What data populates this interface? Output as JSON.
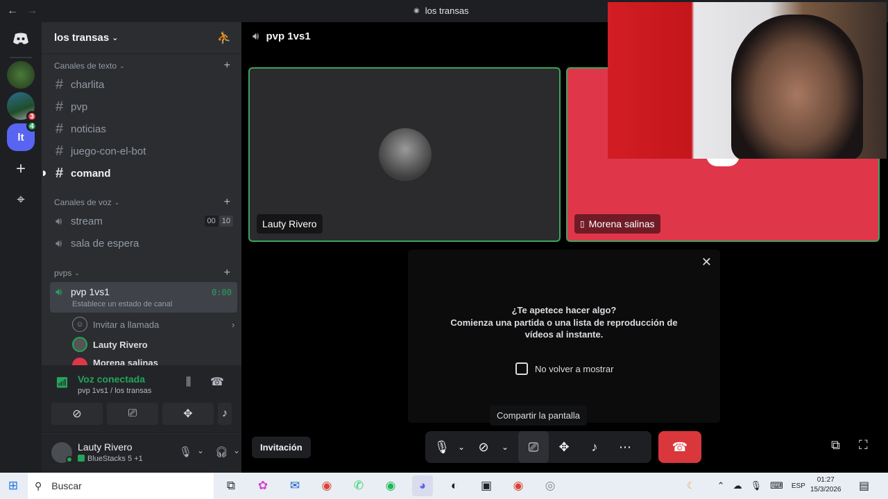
{
  "window": {
    "title": "los transas",
    "back": "←",
    "forward": "→"
  },
  "servers": {
    "items": [
      {
        "name": "discord-home",
        "glyph": "◕"
      },
      {
        "name": "server-green"
      },
      {
        "name": "server-game",
        "badge": "3"
      },
      {
        "name": "server-lt",
        "label": "lt",
        "badge": "4"
      },
      {
        "name": "add-server",
        "glyph": "+"
      },
      {
        "name": "discover",
        "glyph": "⌖"
      }
    ]
  },
  "sidebar": {
    "guild_name": "los transas",
    "text_category": "Canales de texto",
    "text_channels": [
      "charlita",
      "pvp",
      "noticias",
      "juego-con-el-bot",
      "comand"
    ],
    "voice_category": "Canales de voz",
    "voice_channels": [
      {
        "name": "stream",
        "count_a": "00",
        "count_b": "10"
      },
      {
        "name": "sala de espera"
      }
    ],
    "pvps_category": "pvps",
    "active_channel": {
      "name": "pvp 1vs1",
      "timer": "0:00",
      "status": "Establece un estado de canal"
    },
    "invite_call": "Invitar a llamada",
    "members": [
      "Lauty Rivero",
      "Morena salinas"
    ]
  },
  "voice_panel": {
    "status": "Voz conectada",
    "location": "pvp 1vs1 / los transas"
  },
  "user_panel": {
    "name": "Lauty Rivero",
    "activity": "BlueStacks 5 +1"
  },
  "main": {
    "channel_title": "pvp 1vs1",
    "tiles": [
      {
        "name": "Lauty Rivero",
        "bg": "#2b2b2d",
        "border": "#3ba55d"
      },
      {
        "name": "Morena salinas",
        "bg": "#e0364a",
        "border": "#3ba55d"
      }
    ],
    "modal": {
      "heading": "¿Te apetece hacer algo?",
      "body": "Comienza una partida o una lista de reproducción de vídeos al instante.",
      "checkbox_label": "No volver a mostrar",
      "close": "✕"
    },
    "tooltip": "Compartir la pantalla",
    "invite_button": "Invitación"
  },
  "taskbar": {
    "search_placeholder": "Buscar",
    "language": "ESP",
    "time": "01:27",
    "date": "15/3/2026"
  },
  "colors": {
    "accent": "#23a55a",
    "danger": "#da373c",
    "bg": "#000000"
  }
}
